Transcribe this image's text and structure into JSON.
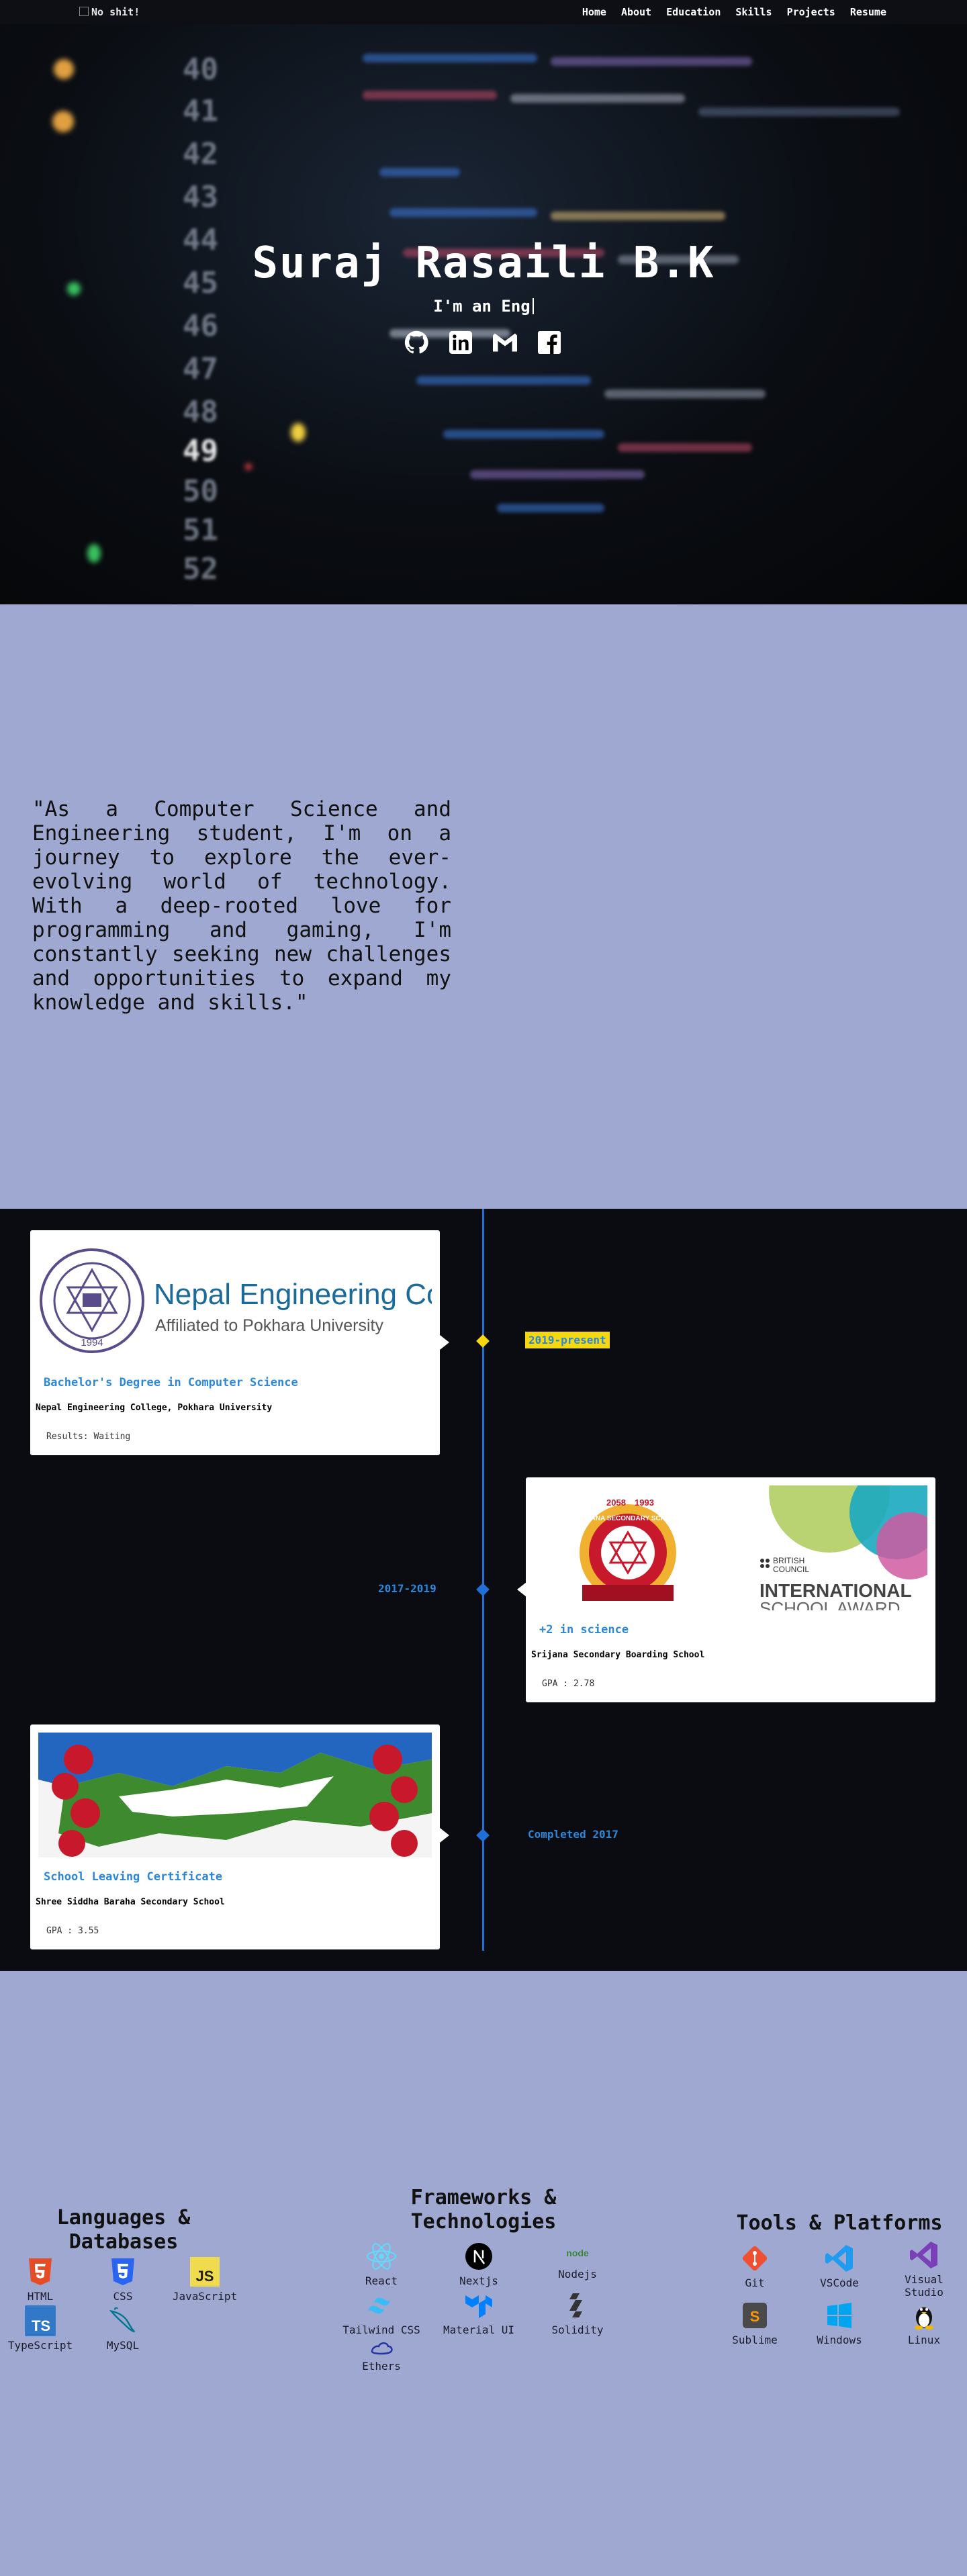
{
  "nav": {
    "logo_alt": "No shit!",
    "links": [
      "Home",
      "About",
      "Education",
      "Skills",
      "Projects",
      "Resume"
    ]
  },
  "hero": {
    "name": "Suraj Rasaili B.K",
    "typed": "I'm an Eng",
    "socials": [
      "github-icon",
      "linkedin-icon",
      "gmail-icon",
      "facebook-icon"
    ],
    "line_numbers": [
      "40",
      "41",
      "42",
      "43",
      "44",
      "45",
      "46",
      "47",
      "48",
      "49",
      "50",
      "51",
      "52"
    ]
  },
  "about": {
    "quote": "\"As a Computer Science and Engineering student, I'm on a journey to explore the ever-evolving world of technology. With a deep-rooted love for programming and gaming, I'm constantly seeking new challenges and opportunities to expand my knowledge and skills.\""
  },
  "education": [
    {
      "date": "2019-present",
      "logo_title": "Nepal Engineering Colleg",
      "logo_subtitle": "Affiliated to Pokhara University",
      "seal_year": "1994",
      "degree": "Bachelor's Degree in Computer Science",
      "institution": "Nepal Engineering College, Pokhara University",
      "result": "Results: Waiting"
    },
    {
      "date": "2017-2019",
      "seal_text": "SRIJANA SECONDARY SCHOOL",
      "badge_years": [
        "2058",
        "1993"
      ],
      "council": [
        "BRITISH",
        "COUNCIL"
      ],
      "award": [
        "INTERNATIONAL",
        "SCHOOL AWARD"
      ],
      "degree": "+2 in science",
      "institution": "Srijana Secondary Boarding School",
      "result": "GPA : 2.78"
    },
    {
      "date": "Completed 2017",
      "degree": "School Leaving Certificate",
      "institution": "Shree Siddha Baraha Secondary School",
      "result": "GPA : 3.55"
    }
  ],
  "skills": {
    "languages": {
      "title": "Languages & Databases",
      "items": [
        {
          "label": "HTML",
          "icon": "html5-icon"
        },
        {
          "label": "CSS",
          "icon": "css3-icon"
        },
        {
          "label": "JavaScript",
          "icon": "javascript-icon"
        },
        {
          "label": "TypeScript",
          "icon": "typescript-icon"
        },
        {
          "label": "MySQL",
          "icon": "mysql-icon"
        }
      ]
    },
    "frameworks": {
      "title": "Frameworks & Technologies",
      "items": [
        {
          "label": "React",
          "icon": "react-icon"
        },
        {
          "label": "Nextjs",
          "icon": "nextjs-icon"
        },
        {
          "label": "Nodejs",
          "icon": "nodejs-icon"
        },
        {
          "label": "Tailwind CSS",
          "icon": "tailwind-icon"
        },
        {
          "label": "Material UI",
          "icon": "material-ui-icon"
        },
        {
          "label": "Solidity",
          "icon": "solidity-icon"
        },
        {
          "label": "Ethers",
          "icon": "ethers-icon"
        }
      ]
    },
    "tools": {
      "title": "Tools & Platforms",
      "items": [
        {
          "label": "Git",
          "icon": "git-icon"
        },
        {
          "label": "VSCode",
          "icon": "vscode-icon"
        },
        {
          "label": "Visual Studio",
          "icon": "visual-studio-icon"
        },
        {
          "label": "Sublime",
          "icon": "sublime-icon"
        },
        {
          "label": "Windows",
          "icon": "windows-icon"
        },
        {
          "label": "Linux",
          "icon": "linux-icon"
        }
      ]
    }
  },
  "colors": {
    "accent_blue": "#2b88d8",
    "timeline": "#1f6fd6",
    "section_bg": "#9ea8d0",
    "dark_bg": "#0b0b12",
    "highlight_yellow": "#f5d80f"
  }
}
